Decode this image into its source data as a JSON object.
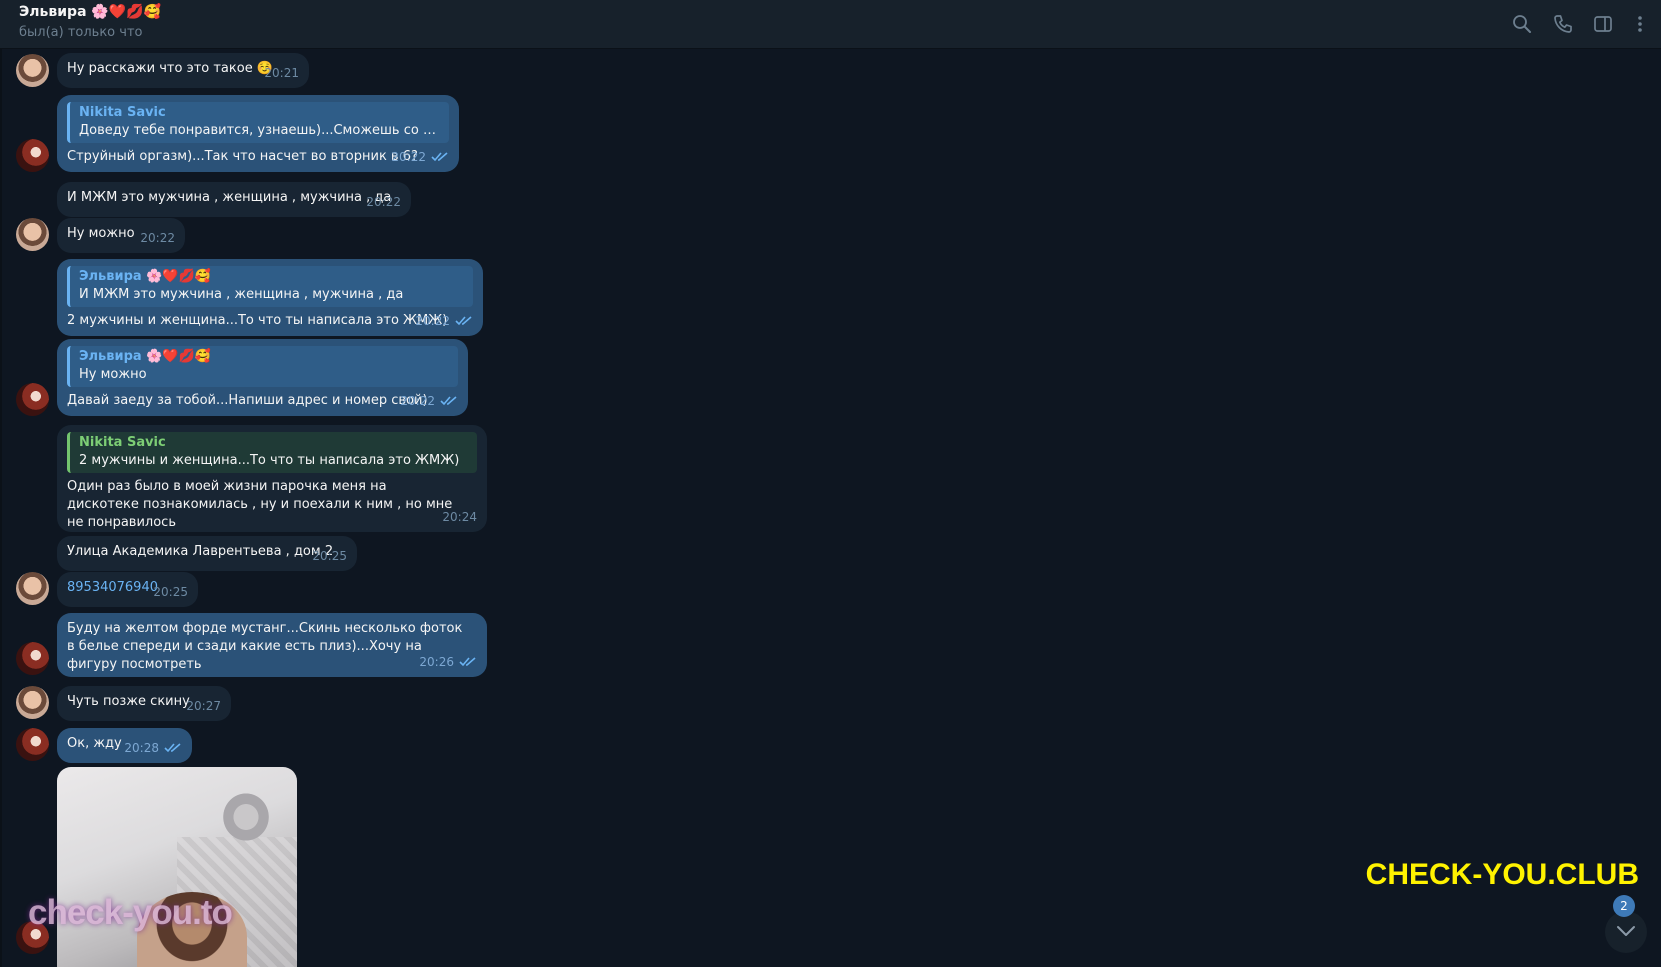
{
  "header": {
    "title": "Эльвира 🌸❤️💋🥰",
    "status": "был(а) только что",
    "icons": [
      "search-icon",
      "phone-icon",
      "sidebar-toggle-icon",
      "more-vertical-icon"
    ]
  },
  "colors": {
    "background": "#0e1621",
    "header": "#17212b",
    "incoming_bubble": "#182533",
    "outgoing_bubble": "#2b5278",
    "accent": "#6ab3f3",
    "watermark_yellow": "#fff200"
  },
  "messages": [
    {
      "from": "Эльвира",
      "text": "Ну расскажи что это такое ☺️",
      "time": "20:21"
    },
    {
      "from": "Nikita Savic",
      "reply": {
        "name": "Nikita Savic",
        "text": "Доведу тебе понравится, узнаешь)...Сможешь со мной в..."
      },
      "text": "Струйный оргазм)...Так что насчет во вторник в 6?",
      "time": "20:22",
      "read": true
    },
    {
      "from": "Эльвира",
      "text": "И МЖМ это мужчина , женщина , мужчина , да",
      "time": "20:22"
    },
    {
      "from": "Эльвира",
      "text": "Ну можно",
      "time": "20:22"
    },
    {
      "from": "Nikita Savic",
      "reply": {
        "name": "Эльвира 🌸❤️💋🥰",
        "text": "И МЖМ это мужчина , женщина , мужчина , да"
      },
      "text": "2 мужчины и женщина...То что ты написала это ЖМЖ)",
      "time": "20:22",
      "read": true
    },
    {
      "from": "Nikita Savic",
      "reply": {
        "name": "Эльвира 🌸❤️💋🥰",
        "text": "Ну можно"
      },
      "text": "Давай заеду за тобой...Напиши адрес и номер свой)",
      "time": "20:22",
      "read": true
    },
    {
      "from": "Эльвира",
      "reply": {
        "name": "Nikita Savic",
        "text": "2 мужчины и женщина...То что ты написала это ЖМЖ)"
      },
      "text": "Один раз было в моей жизни парочка меня на дискотеке познакомилась , ну и поехали к ним , но мне не понравилось",
      "time": "20:24"
    },
    {
      "from": "Эльвира",
      "text": "Улица Академика Лаврентьева , дом 2",
      "time": "20:25"
    },
    {
      "from": "Эльвира",
      "text": "89534076940",
      "time": "20:25"
    },
    {
      "from": "Nikita Savic",
      "text": "Буду на желтом форде мустанг...Скинь несколько фоток в белье спереди и сзади какие есть плиз)...Хочу на фигуру посмотреть",
      "time": "20:26",
      "read": true
    },
    {
      "from": "Эльвира",
      "text": "Чуть позже скину",
      "time": "20:27"
    },
    {
      "from": "Nikita Savic",
      "text": "Ок, жду",
      "time": "20:28",
      "read": true
    }
  ],
  "watermarks": {
    "left": "check-you.to",
    "right": "CHECK-YOU.CLUB"
  },
  "scroll_down": {
    "unread_count": "2"
  }
}
